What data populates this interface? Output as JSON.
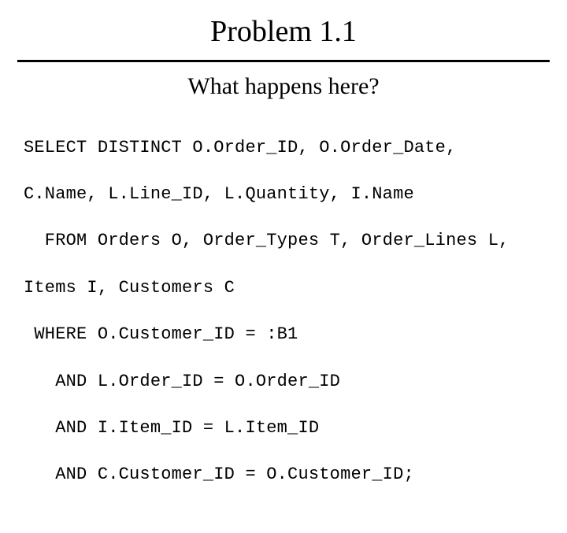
{
  "title": "Problem 1.1",
  "subtitle": "What happens here?",
  "code": {
    "l1": "SELECT DISTINCT O.Order_ID, O.Order_Date,",
    "l2": "C.Name, L.Line_ID, L.Quantity, I.Name",
    "l3": "  FROM Orders O, Order_Types T, Order_Lines L,",
    "l4": "Items I, Customers C",
    "l5": " WHERE O.Customer_ID = :B1",
    "l6": "   AND L.Order_ID = O.Order_ID",
    "l7": "   AND I.Item_ID = L.Item_ID",
    "l8": "   AND C.Customer_ID = O.Customer_ID;"
  }
}
